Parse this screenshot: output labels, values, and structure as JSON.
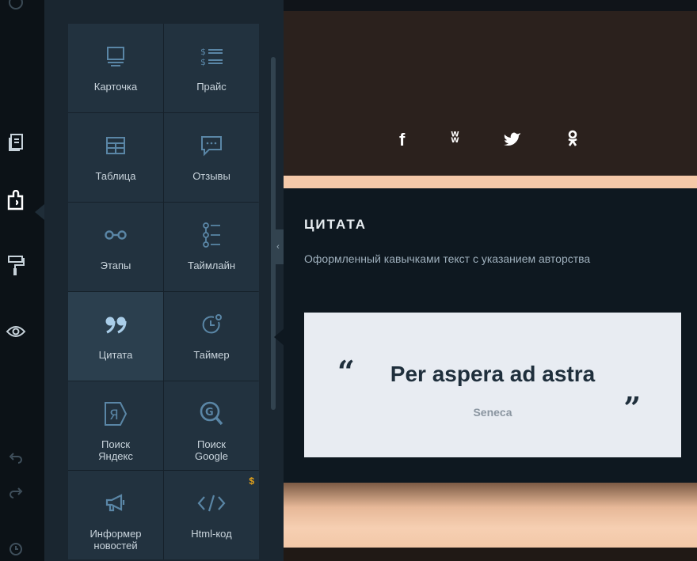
{
  "sidebar_rail": {
    "icons": [
      "clock-icon",
      "pages-icon",
      "blocks-icon",
      "paint-roller-icon",
      "eye-icon",
      "undo-icon",
      "redo-icon",
      "history-icon"
    ]
  },
  "blocks_panel": {
    "tiles": [
      {
        "label": "Карточка",
        "icon": "monitor-icon"
      },
      {
        "label": "Прайс",
        "icon": "price-list-icon"
      },
      {
        "label": "Таблица",
        "icon": "table-icon"
      },
      {
        "label": "Отзывы",
        "icon": "reviews-icon"
      },
      {
        "label": "Этапы",
        "icon": "stages-icon"
      },
      {
        "label": "Таймлайн",
        "icon": "timeline-icon"
      },
      {
        "label": "Цитата",
        "icon": "quote-icon"
      },
      {
        "label": "Таймер",
        "icon": "timer-icon"
      },
      {
        "label": "Поиск\nЯндекс",
        "icon": "yandex-search-icon"
      },
      {
        "label": "Поиск\nGoogle",
        "icon": "google-search-icon"
      },
      {
        "label": "Информер\nновостей",
        "icon": "megaphone-icon"
      },
      {
        "label": "Html-код",
        "icon": "code-icon",
        "badge": "$"
      }
    ],
    "active_tile": "Цитата"
  },
  "canvas": {
    "social_icons": [
      "f",
      "vk",
      "twitter-bird",
      "ok"
    ],
    "quote_section": {
      "title": "ЦИТАТА",
      "description": "Оформленный кавычками текст с указанием авторства",
      "quote_text": "Per aspera ad astra",
      "open_mark": "“",
      "close_mark": "„",
      "author": "Seneca"
    }
  },
  "colors": {
    "panel_bg": "#1a2630",
    "tile_bg": "#22323f",
    "tile_active_bg": "#2b3f4e",
    "icon_blue": "#5a86a6",
    "peach": "#f5c9a9",
    "quote_card_bg": "#e8ecf2",
    "badge_gold": "#e3a21b"
  }
}
